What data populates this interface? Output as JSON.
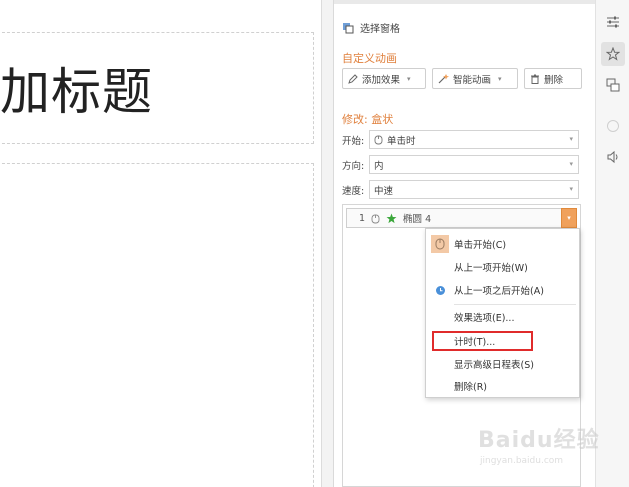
{
  "slide": {
    "title_text": "加标题"
  },
  "pane": {
    "selection_pane_label": "选择窗格",
    "custom_animation_title": "自定义动画",
    "add_effect_label": "添加效果",
    "smart_animation_label": "智能动画",
    "delete_label": "删除",
    "modify_title": "修改: 盒状",
    "start_label": "开始:",
    "start_value": "单击时",
    "direction_label": "方向:",
    "direction_value": "内",
    "speed_label": "速度:",
    "speed_value": "中速",
    "animation_item": {
      "index": "1",
      "name": "椭圆 4"
    }
  },
  "context_menu": {
    "items": [
      {
        "label": "单击开始(C)"
      },
      {
        "label": "从上一项开始(W)"
      },
      {
        "label": "从上一项之后开始(A)"
      },
      {
        "label": "效果选项(E)..."
      },
      {
        "label": "计时(T)..."
      },
      {
        "label": "显示高级日程表(S)"
      },
      {
        "label": "删除(R)"
      }
    ],
    "highlighted": "计时(T)..."
  },
  "watermark": {
    "brand": "Baidu经验",
    "url": "jingyan.baidu.com"
  },
  "colors": {
    "accent_orange": "#e0803d",
    "drop_button": "#f0a15c",
    "highlight_red": "#e02b2b",
    "star_green": "#3aa63a"
  },
  "icons": {
    "strip": [
      "settings-sliders-icon",
      "animation-star-icon",
      "slide-transition-icon",
      "disabled-circle-icon",
      "sound-icon"
    ]
  }
}
